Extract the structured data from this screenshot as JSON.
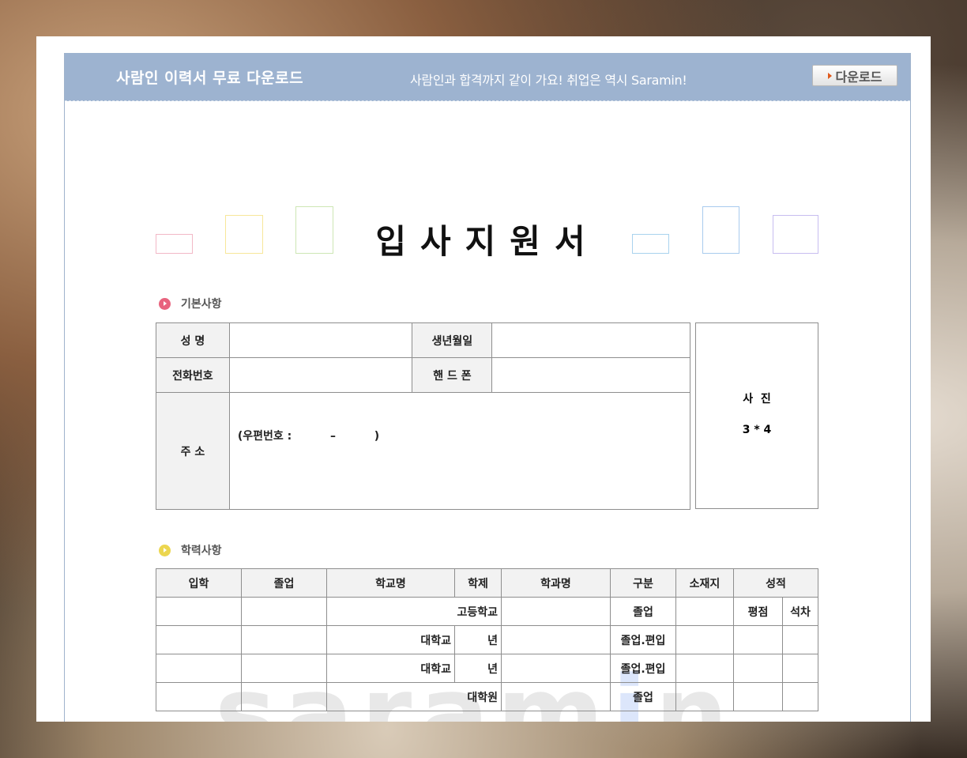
{
  "banner": {
    "title": "사람인 이력서 무료 다운로드",
    "slogan": "사람인과 합격까지 같이 가요! 취업은 역시 Saramin!",
    "download_label": "다운로드"
  },
  "document": {
    "title": "입사지원서",
    "deco_colors": [
      "#f2b8c6",
      "#f7e79a",
      "#cde6b4",
      "#a9d3ee",
      "#a9cbee",
      "#c7bdf0"
    ]
  },
  "basic_info": {
    "heading": "기본사항",
    "bullet_color": "#e8637e",
    "name_label": "성    명",
    "birth_label": "생년월일",
    "phone_label": "전화번호",
    "mobile_label": "핸 드 폰",
    "address_label": "주    소",
    "postal_text": "(우편번호 :          –          )",
    "photo_label": "사  진",
    "photo_size": "3 * 4"
  },
  "education": {
    "heading": "학력사항",
    "bullet_color": "#ecd64f",
    "headers": [
      "입학",
      "졸업",
      "학교명",
      "학제",
      "학과명",
      "구분",
      "소재지",
      "성적"
    ],
    "grade_sub": [
      "평점",
      "석차"
    ],
    "rows": [
      {
        "school": "고등학교",
        "system": "",
        "type": "졸업"
      },
      {
        "school": "대학교",
        "system": "년",
        "type": "졸업.편입"
      },
      {
        "school": "대학교",
        "system": "년",
        "type": "졸업.편입"
      },
      {
        "school": "대학원",
        "system": "",
        "type": "졸업"
      }
    ]
  },
  "watermark": {
    "pre": "sara",
    "accent": "m",
    "accent2": "i",
    "post": "n"
  }
}
